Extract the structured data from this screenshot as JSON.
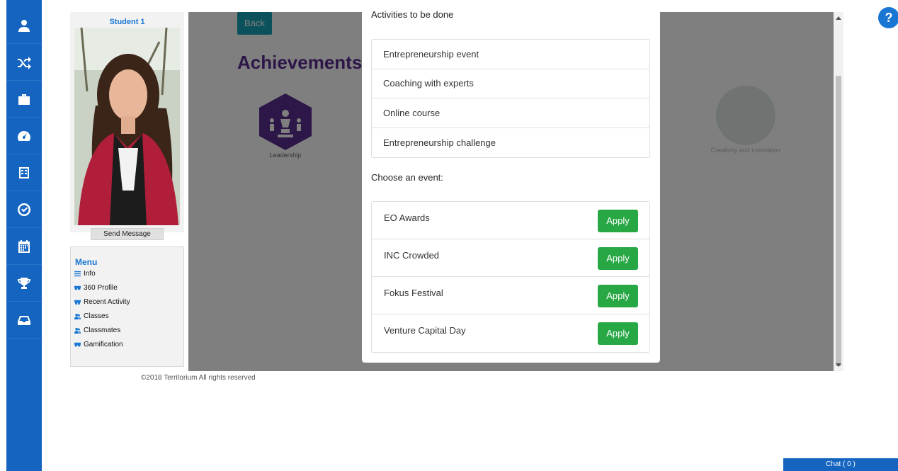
{
  "profile": {
    "name": "Student 1",
    "send_message": "Send Message"
  },
  "menu": {
    "title": "Menu",
    "items": [
      {
        "label": "Info",
        "icon": "list-icon"
      },
      {
        "label": "360 Profile",
        "icon": "glasses-icon"
      },
      {
        "label": "Recent Activity",
        "icon": "activity-icon"
      },
      {
        "label": "Classes",
        "icon": "users-icon"
      },
      {
        "label": "Classmates",
        "icon": "users-icon"
      },
      {
        "label": "Gamification",
        "icon": "glasses-icon"
      }
    ]
  },
  "footer": "©2018 Territorium All rights reserved",
  "page": {
    "back_label": "Back",
    "title": "Achievements",
    "badges": [
      {
        "label": "Leadership",
        "icon": "leadership-icon",
        "color": "#5b2d91"
      },
      {
        "label": "Creativity and innovation",
        "icon": "brain-icon"
      }
    ]
  },
  "modal": {
    "activities_heading": "Activities to be done",
    "activities": [
      "Entrepreneurship event",
      "Coaching with experts",
      "Online course",
      "Entrepreneurship challenge"
    ],
    "choose_heading": "Choose an event:",
    "events": [
      {
        "name": "EO Awards",
        "action": "Apply"
      },
      {
        "name": "INC Crowded",
        "action": "Apply"
      },
      {
        "name": "Fokus Festival",
        "action": "Apply"
      },
      {
        "name": "Venture Capital Day",
        "action": "Apply"
      }
    ]
  },
  "chat": "Chat ( 0 )",
  "help": "?",
  "colors": {
    "rail": "#1565c0",
    "apply": "#28a745",
    "back": "#17a2b8",
    "title": "#5b2d91"
  }
}
